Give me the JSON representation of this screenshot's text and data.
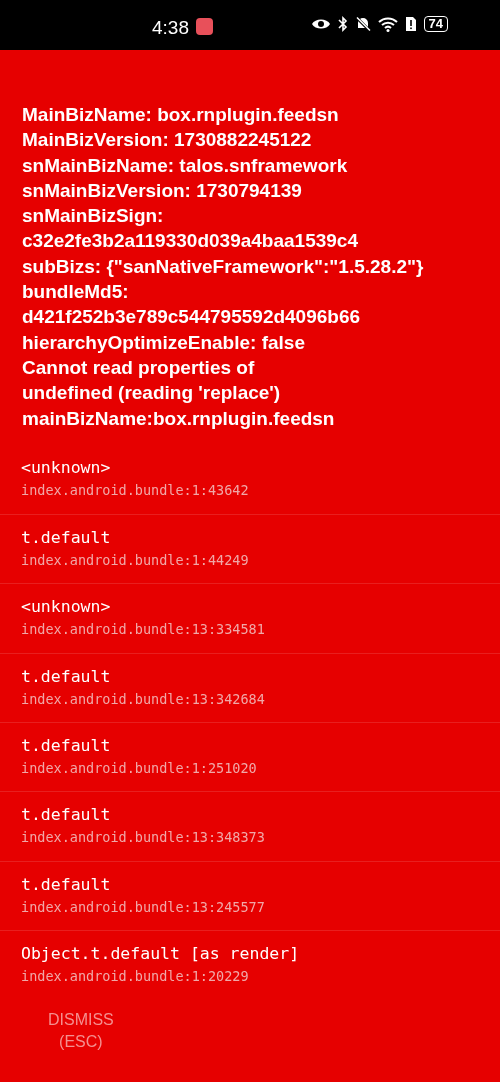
{
  "status_bar": {
    "time": "4:38",
    "battery": "74"
  },
  "message": [
    "MainBizName: box.rnplugin.feedsn",
    "MainBizVersion: 1730882245122",
    "snMainBizName: talos.snframework",
    "snMainBizVersion: 1730794139",
    "snMainBizSign:",
    "c32e2fe3b2a119330d039a4baa1539c4",
    "subBizs: {\"sanNativeFramework\":\"1.5.28.2\"}",
    "bundleMd5:",
    "d421f252b3e789c544795592d4096b66",
    "hierarchyOptimizeEnable: false",
    "Cannot read properties of",
    "undefined (reading 'replace')",
    "mainBizName:box.rnplugin.feedsn"
  ],
  "stack": [
    {
      "method": "<unknown>",
      "location": "index.android.bundle:1:43642"
    },
    {
      "method": "t.default",
      "location": "index.android.bundle:1:44249"
    },
    {
      "method": "<unknown>",
      "location": "index.android.bundle:13:334581"
    },
    {
      "method": "t.default",
      "location": "index.android.bundle:13:342684"
    },
    {
      "method": "t.default",
      "location": "index.android.bundle:1:251020"
    },
    {
      "method": "t.default",
      "location": "index.android.bundle:13:348373"
    },
    {
      "method": "t.default",
      "location": "index.android.bundle:13:245577"
    },
    {
      "method": "Object.t.default [as render]",
      "location": "index.android.bundle:1:20229"
    }
  ],
  "buttons": [
    {
      "label": "DISMISS\n(ESC)"
    }
  ]
}
